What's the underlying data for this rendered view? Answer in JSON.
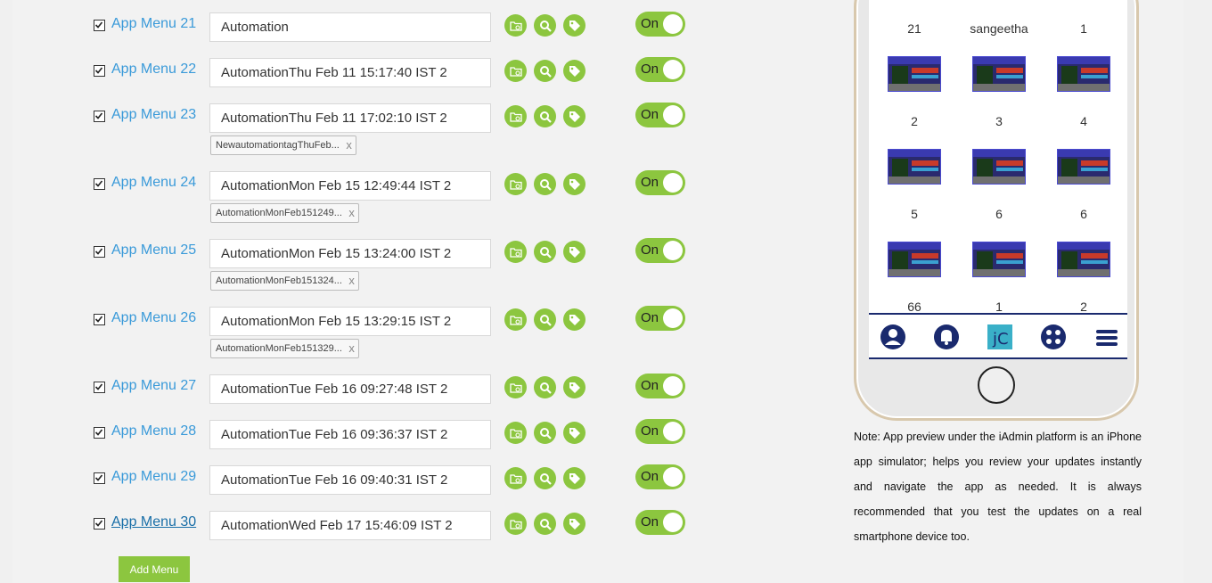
{
  "menus": [
    {
      "label": "App Menu 21",
      "value": "Automation",
      "toggle": "On",
      "tag": null
    },
    {
      "label": "App Menu 22",
      "value": "AutomationThu Feb 11 15:17:40 IST 2",
      "toggle": "On",
      "tag": null
    },
    {
      "label": "App Menu 23",
      "value": "AutomationThu Feb 11 17:02:10 IST 2",
      "toggle": "On",
      "tag": "NewautomationtagThuFeb..."
    },
    {
      "label": "App Menu 24",
      "value": "AutomationMon Feb 15 12:49:44 IST 2",
      "toggle": "On",
      "tag": "AutomationMonFeb151249..."
    },
    {
      "label": "App Menu 25",
      "value": "AutomationMon Feb 15 13:24:00 IST 2",
      "toggle": "On",
      "tag": "AutomationMonFeb151324..."
    },
    {
      "label": "App Menu 26",
      "value": "AutomationMon Feb 15 13:29:15 IST 2",
      "toggle": "On",
      "tag": "AutomationMonFeb151329..."
    },
    {
      "label": "App Menu 27",
      "value": "AutomationTue Feb 16 09:27:48 IST 2",
      "toggle": "On",
      "tag": null
    },
    {
      "label": "App Menu 28",
      "value": "AutomationTue Feb 16 09:36:37 IST 2",
      "toggle": "On",
      "tag": null
    },
    {
      "label": "App Menu 29",
      "value": "AutomationTue Feb 16 09:40:31 IST 2",
      "toggle": "On",
      "tag": null
    },
    {
      "label": "App Menu 30",
      "value": "AutomationWed Feb 17 15:46:09 IST 2",
      "toggle": "On",
      "tag": null
    }
  ],
  "tag_close": "x",
  "add_menu_label": "Add Menu",
  "phone": {
    "top_row": [
      "21",
      "sangeetha",
      "1"
    ],
    "grid_rows": [
      [
        "2",
        "3",
        "4"
      ],
      [
        "5",
        "6",
        "6"
      ],
      [
        "66",
        "1",
        "2"
      ]
    ],
    "nav_icons": [
      "user-icon",
      "bell-icon",
      "app-logo-icon",
      "gamepad-icon",
      "hamburger-menu-icon"
    ]
  },
  "note": "Note: App preview under the iAdmin platform is an iPhone app simulator; helps you review your updates instantly and navigate the app as needed. It is always recommended that you test the updates on a real smartphone device too.",
  "colors": {
    "accent_green": "#8cc63f",
    "link_blue": "#3a9ad9",
    "nav_blue": "#1a2a6e"
  }
}
